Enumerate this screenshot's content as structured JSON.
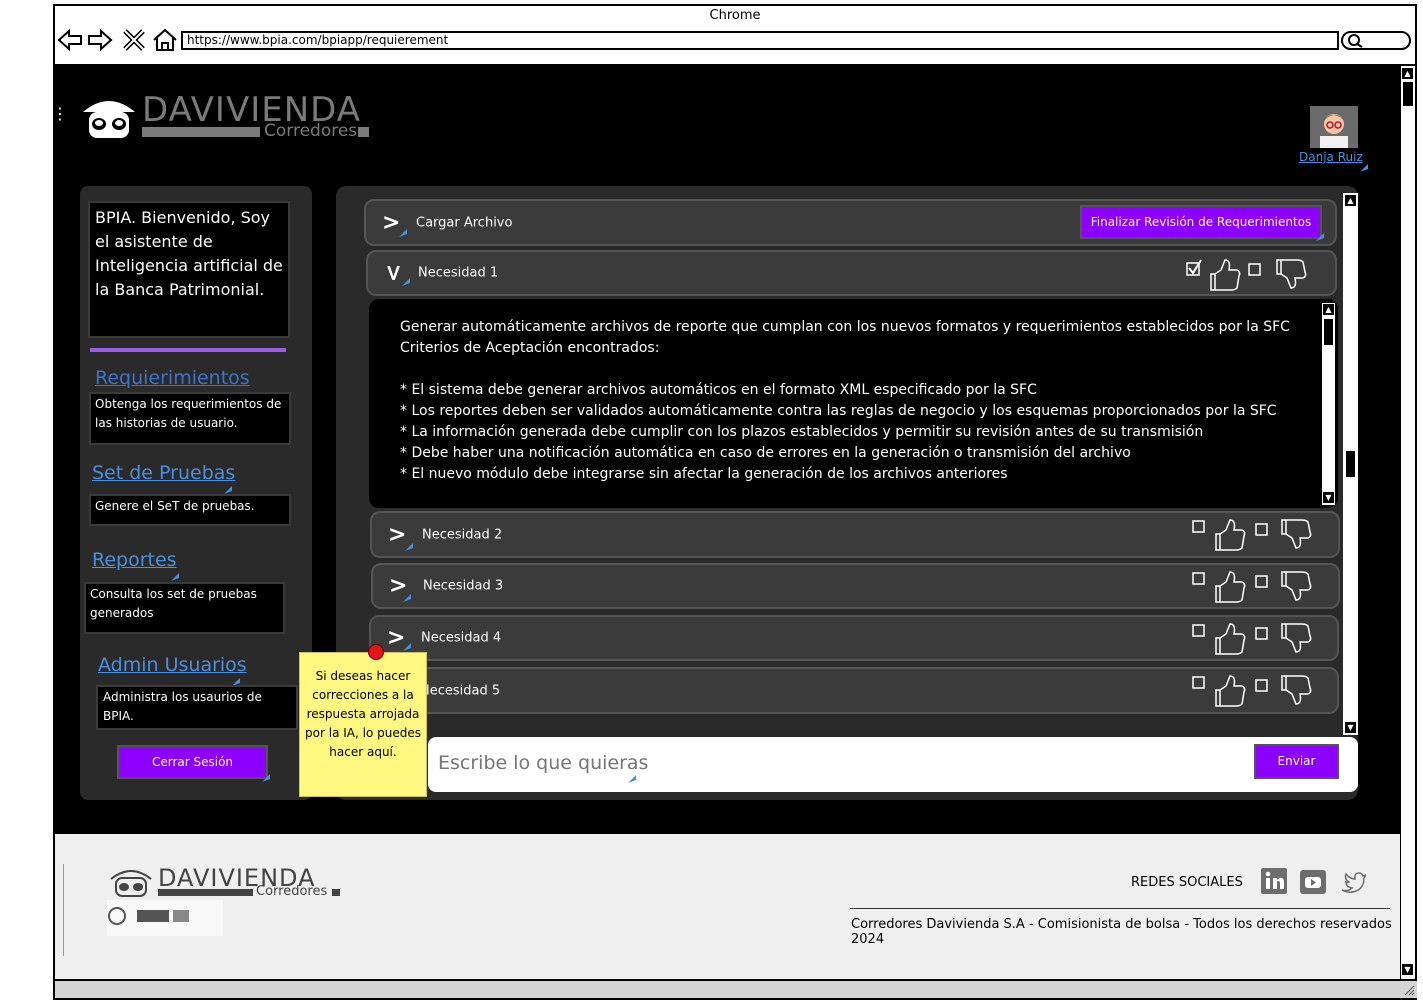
{
  "browser": {
    "title": "Chrome",
    "url": "https://www.bpia.com/bpiapp/requierement"
  },
  "header": {
    "logo_name": "DAVIVIENDA",
    "logo_sub": "Corredores",
    "user_name": "Danja Ruiz"
  },
  "sidebar": {
    "intro": "BPIA. Bienvenido, Soy el asistente de Inteligencia artificial de la Banca Patrimonial.",
    "items": [
      {
        "label": "Requierimientos",
        "desc": "Obtenga los requerimientos de las historias de usuario."
      },
      {
        "label": "Set de Pruebas",
        "desc": "Genere el SeT de pruebas."
      },
      {
        "label": "Reportes",
        "desc": "Consulta los set de pruebas generados"
      },
      {
        "label": "Admin Usuarios",
        "desc": "Administra los usaurios de BPIA."
      }
    ],
    "logout": "Cerrar Sesión"
  },
  "main": {
    "upload_label": "Cargar Archivo",
    "finish_button": "Finalizar Revisión de Requerimientos",
    "needs": [
      {
        "label": "Necesidad 1",
        "expanded": true,
        "checked": true
      },
      {
        "label": "Necesidad 2"
      },
      {
        "label": "Necesidad 3"
      },
      {
        "label": "Necesidad 4"
      },
      {
        "label": "Necesidad 5"
      }
    ],
    "detail": {
      "line1": "Generar automáticamente archivos de reporte que cumplan con los nuevos formatos y requerimientos establecidos por la SFC",
      "line2": "Criterios de Aceptación encontrados:",
      "criteria": [
        "* El sistema debe generar archivos automáticos en el formato XML especificado por la SFC",
        "* Los reportes deben ser validados automáticamente contra las reglas de negocio y los esquemas proporcionados por la SFC",
        "* La información generada debe cumplir con los plazos establecidos y permitir su revisión antes de su transmisión",
        "* Debe haber una notificación automática en caso de errores en la generación o transmisión del archivo",
        "* El nuevo módulo debe integrarse sin afectar la generación de los archivos anteriores"
      ]
    },
    "chat_placeholder": "Escribe lo que quieras",
    "send_button": "Enviar"
  },
  "sticky_note": "Si deseas hacer correcciones a la respuesta arrojada por la IA, lo puedes hacer aquí.",
  "footer": {
    "logo_name": "DAVIVIENDA",
    "logo_sub": "Corredores",
    "social_label": "REDES SOCIALES",
    "copyright": "Corredores Davivienda S.A - Comisionista de bolsa - Todos los derechos reservados 2024"
  },
  "colors": {
    "accent": "#8b00ff",
    "panel": "#2a2a2a",
    "row": "#3b3b3b",
    "link": "#4a8fe0",
    "sticky": "#fff780"
  }
}
